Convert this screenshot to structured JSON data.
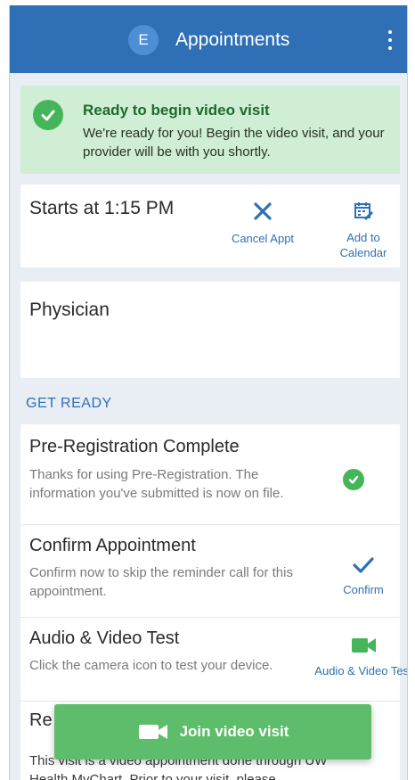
{
  "header": {
    "avatar_initial": "E",
    "title": "Appointments",
    "menu_icon": "more-vertical-icon"
  },
  "banner": {
    "icon": "check-circle-icon",
    "title": "Ready to begin video visit",
    "text": "We're ready for you! Begin the video visit, and your provider will be with you shortly."
  },
  "appointment": {
    "start_text": "Starts at 1:15 PM",
    "cancel": {
      "icon": "close-icon",
      "label": "Cancel Appt"
    },
    "calendar": {
      "icon": "calendar-icon",
      "label": "Add to Calendar"
    },
    "provider": "Physician"
  },
  "get_ready": {
    "heading": "GET READY",
    "items": [
      {
        "title": "Pre-Registration Complete",
        "description": "Thanks for using Pre-Registration. The information you've submitted is now on file.",
        "status_icon": "check-circle-icon"
      },
      {
        "title": "Confirm Appointment",
        "description": "Confirm now to skip the reminder call for this appointment.",
        "action_icon": "checkmark-icon",
        "action_label": "Confirm"
      },
      {
        "title": "Audio & Video Test",
        "description": "Click the camera icon to test your device.",
        "action_icon": "video-camera-icon",
        "action_label": "Audio & Video Test"
      },
      {
        "title": "Re",
        "description": "This visit is a video appointment done through UW Health MyChart. Prior to your visit, please"
      }
    ]
  },
  "join_button": {
    "icon": "video-camera-icon",
    "label": "Join video visit"
  },
  "colors": {
    "header": "#2f6fb6",
    "accent_blue": "#2f6fb6",
    "success_green": "#45b55a",
    "banner_bg": "#cfeed3",
    "join_button": "#5ebd6a",
    "page_bg": "#e9eef4"
  }
}
